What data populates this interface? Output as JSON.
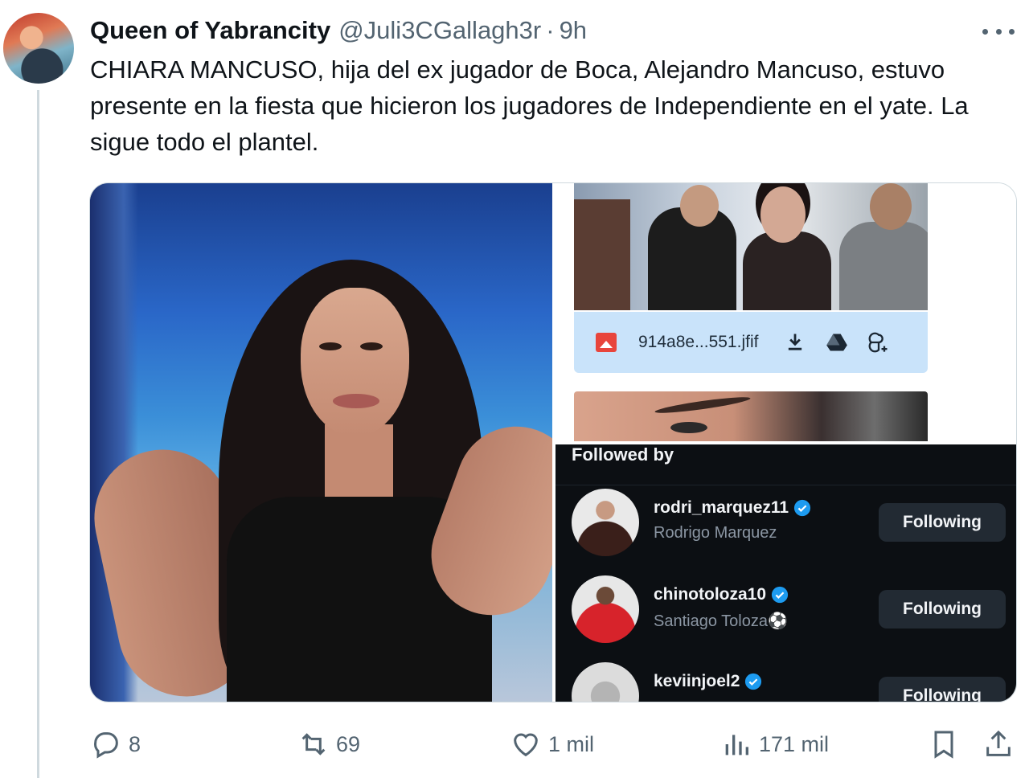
{
  "tweet": {
    "author_name": "Queen of Yabrancity",
    "author_handle": "@Juli3CGallagh3r",
    "separator": "·",
    "time": "9h",
    "text": "CHIARA MANCUSO, hija del ex jugador de Boca, Alejandro Mancuso, estuvo presente en la fiesta que hicieron los jugadores de Independiente en el yate. La sigue todo el plantel."
  },
  "media": {
    "file_bar": {
      "file_name": "914a8e...551.jfif",
      "icons": [
        "image-file-icon",
        "download-icon",
        "google-drive-icon",
        "google-photos-icon"
      ]
    },
    "followed_by": {
      "title": "Followed by",
      "users": [
        {
          "username": "rodri_marquez11",
          "name": "Rodrigo Marquez",
          "button": "Following",
          "verified": true
        },
        {
          "username": "chinotoloza10",
          "name": "Santiago Toloza⚽",
          "button": "Following",
          "verified": true
        },
        {
          "username": "keviinjoel2",
          "name": "",
          "button": "Following",
          "verified": true
        }
      ]
    }
  },
  "actions": {
    "replies": "8",
    "retweets": "69",
    "likes": "1 mil",
    "views": "171 mil"
  },
  "colors": {
    "text_primary": "#0f1419",
    "text_secondary": "#536471",
    "verified_blue": "#1d9bf0",
    "dark_panel": "#0c0f13",
    "file_bar_bg": "#c9e3fa"
  }
}
